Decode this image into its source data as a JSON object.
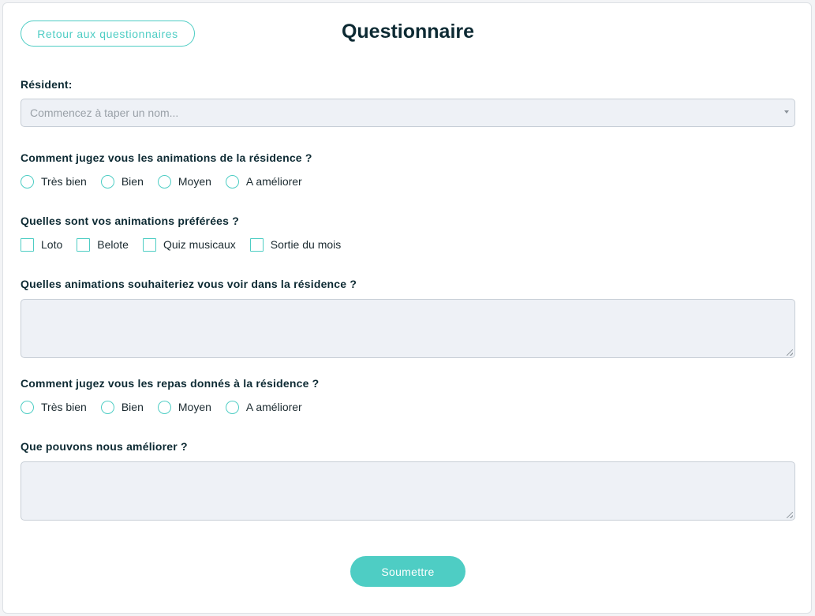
{
  "header": {
    "back_label": "Retour aux questionnaires",
    "title": "Questionnaire"
  },
  "resident": {
    "label": "Résident:",
    "placeholder": "Commencez à taper un nom..."
  },
  "q1": {
    "label": "Comment jugez vous les animations de la résidence ?",
    "options": [
      "Très bien",
      "Bien",
      "Moyen",
      "A améliorer"
    ]
  },
  "q2": {
    "label": "Quelles sont vos animations préférées ?",
    "options": [
      "Loto",
      "Belote",
      "Quiz musicaux",
      "Sortie du mois"
    ]
  },
  "q3": {
    "label": "Quelles animations souhaiteriez vous voir dans la résidence ?"
  },
  "q4": {
    "label": "Comment jugez vous les repas donnés à la résidence ?",
    "options": [
      "Très bien",
      "Bien",
      "Moyen",
      "A améliorer"
    ]
  },
  "q5": {
    "label": "Que pouvons nous améliorer ?"
  },
  "submit_label": "Soumettre",
  "colors": {
    "accent": "#4ecdc4",
    "title": "#0d2a33",
    "field_bg": "#eef1f6"
  }
}
